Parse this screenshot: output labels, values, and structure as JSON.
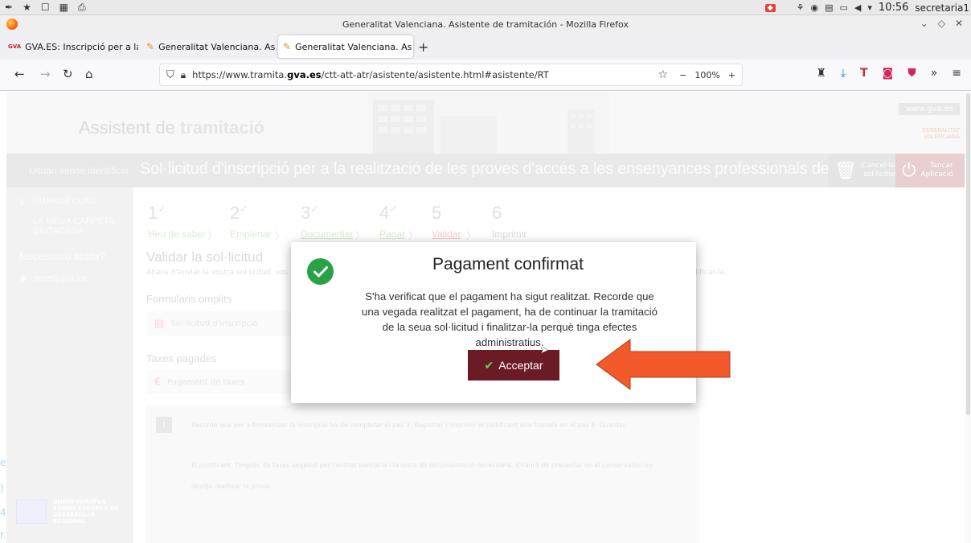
{
  "os_panel": {
    "clock": "10:56",
    "user": "secretaria1"
  },
  "window": {
    "title": "Generalitat Valenciana. Asistente de tramitación - Mozilla Firefox"
  },
  "tabs": [
    {
      "label": "GVA.ES: Inscripció per a la",
      "favicon": "gva-icon"
    },
    {
      "label": "Generalitat Valenciana. As",
      "favicon": "pen-icon"
    },
    {
      "label": "Generalitat Valenciana. As",
      "favicon": "pen-icon",
      "active": true
    }
  ],
  "navbar": {
    "url_prefix": "https://www.tramita.",
    "url_domain": "gva.es",
    "url_suffix": "/ctt-att-atr/asistente/asistente.html#asistente/RT",
    "zoom": "100%"
  },
  "header": {
    "app_title_prefix": "Assistent ",
    "app_title_mid": "de ",
    "app_title_bold": "tramitació",
    "www_link": "www.gva.es",
    "logo_line1": "GENERALITAT",
    "logo_line2": "VALENCIANA"
  },
  "bar": {
    "user_label": "Usuari sense identificar",
    "form_title": "Sol·licitud d'inscripció per a la realització de les proves d'accés a les ensenyances professionals de música i dansa",
    "cancel_line1": "Cancel·lar",
    "cancel_line2": "sol·licitud",
    "close_line1": "Tancar",
    "close_line2": "Aplicació"
  },
  "sidebar": {
    "save_key": "GUARDA CLAU",
    "my_folder": "LA MEUA CARPETA CIUTADANA",
    "help_title": "Necessiteu ajuda?",
    "help_mail": "sere@gva.es",
    "eu_line1": "UNIÓN EUROPEA",
    "eu_line2": "FONDO EUROPEO DE",
    "eu_line3": "DESARROLLO REGIONAL"
  },
  "stray_text": [
    "e",
    ")",
    "4",
    "r."
  ],
  "steps": [
    {
      "num": "1",
      "label": "Heu de saber",
      "state": "done"
    },
    {
      "num": "2",
      "label": "Emplenar",
      "state": "done"
    },
    {
      "num": "3",
      "label": "Documentar",
      "state": "done"
    },
    {
      "num": "4",
      "label": "Pagar",
      "state": "done"
    },
    {
      "num": "5",
      "label": "Validar",
      "state": "current"
    },
    {
      "num": "6",
      "label": "Imprimir",
      "state": "pending"
    }
  ],
  "content": {
    "heading": "Validar la sol·licitud",
    "intro_start": "Abans d'enviar la vostra sol·licitud, vos mos",
    "intro_end": "dificar-la.",
    "forms_section": "Formularis omplits",
    "form_item": "Sol·licitud d'inscripció",
    "fees_section": "Taxes pagades",
    "fee_item": "Pagament de taxes",
    "info_line1": "Recorde que per a formalitzar la inscripció ha de completar el pas 3: Registrar i imprimir el justificant que trobarà en el pas 4: Guardar.",
    "info_line2": "El justificant, l'imprès de taxes segellat per l'entitat bancària i la resta de documentació necessària, s'haurà de presentar en el conservatori on",
    "info_line3": "desitja realitzar la prova."
  },
  "modal": {
    "title": "Pagament confirmat",
    "message": "S'ha verificat que el pagament ha sigut realitzat. Recorde que una vegada realitzat el pagament, ha de continuar la tramitació de la seua sol·licitud i finalitzar-la perquè tinga efectes administratius.",
    "accept_label": "Acceptar"
  },
  "colors": {
    "accept_bg": "#6b1b25",
    "success_green": "#2aa146",
    "annotation_arrow": "#f25a2c"
  }
}
